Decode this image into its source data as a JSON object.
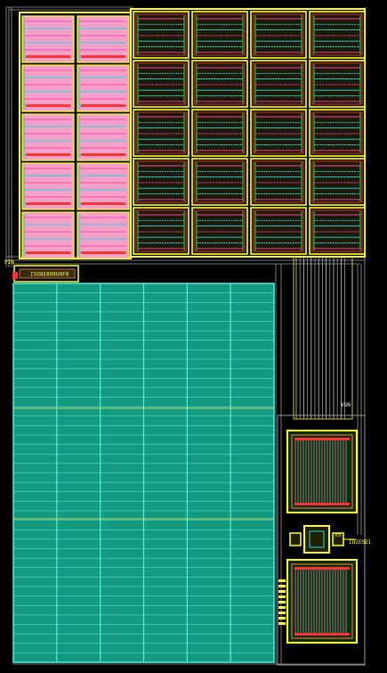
{
  "layout_view": {
    "background": "#000000",
    "palette": {
      "boundary": "#ffff33",
      "metal_cyan": "#22dddd",
      "fill_pink": "#f4a0c8",
      "fill_magenta": "#ff44aa",
      "poly_red": "#ff3333",
      "diff_green": "#33cc66",
      "array_fill": "#159a82",
      "array_grid": "#55eedd",
      "routing_grey": "#9a9a9a",
      "cap_orange": "#ff8833"
    },
    "labels": {
      "pin_top_left": "PIN",
      "instance_strip": "ISO8E8U8U8F8",
      "pin_right_mid": "VSN",
      "pin_right_a": "VS",
      "pin_right_b": "IO2ESD1"
    },
    "blocks": {
      "pink_cells": {
        "rows": 5,
        "cols": 2
      },
      "yellow_cells": {
        "rows": 5,
        "cols": 4
      },
      "array": {
        "rows": 40,
        "cols": 6
      },
      "right_caps": 2
    }
  }
}
